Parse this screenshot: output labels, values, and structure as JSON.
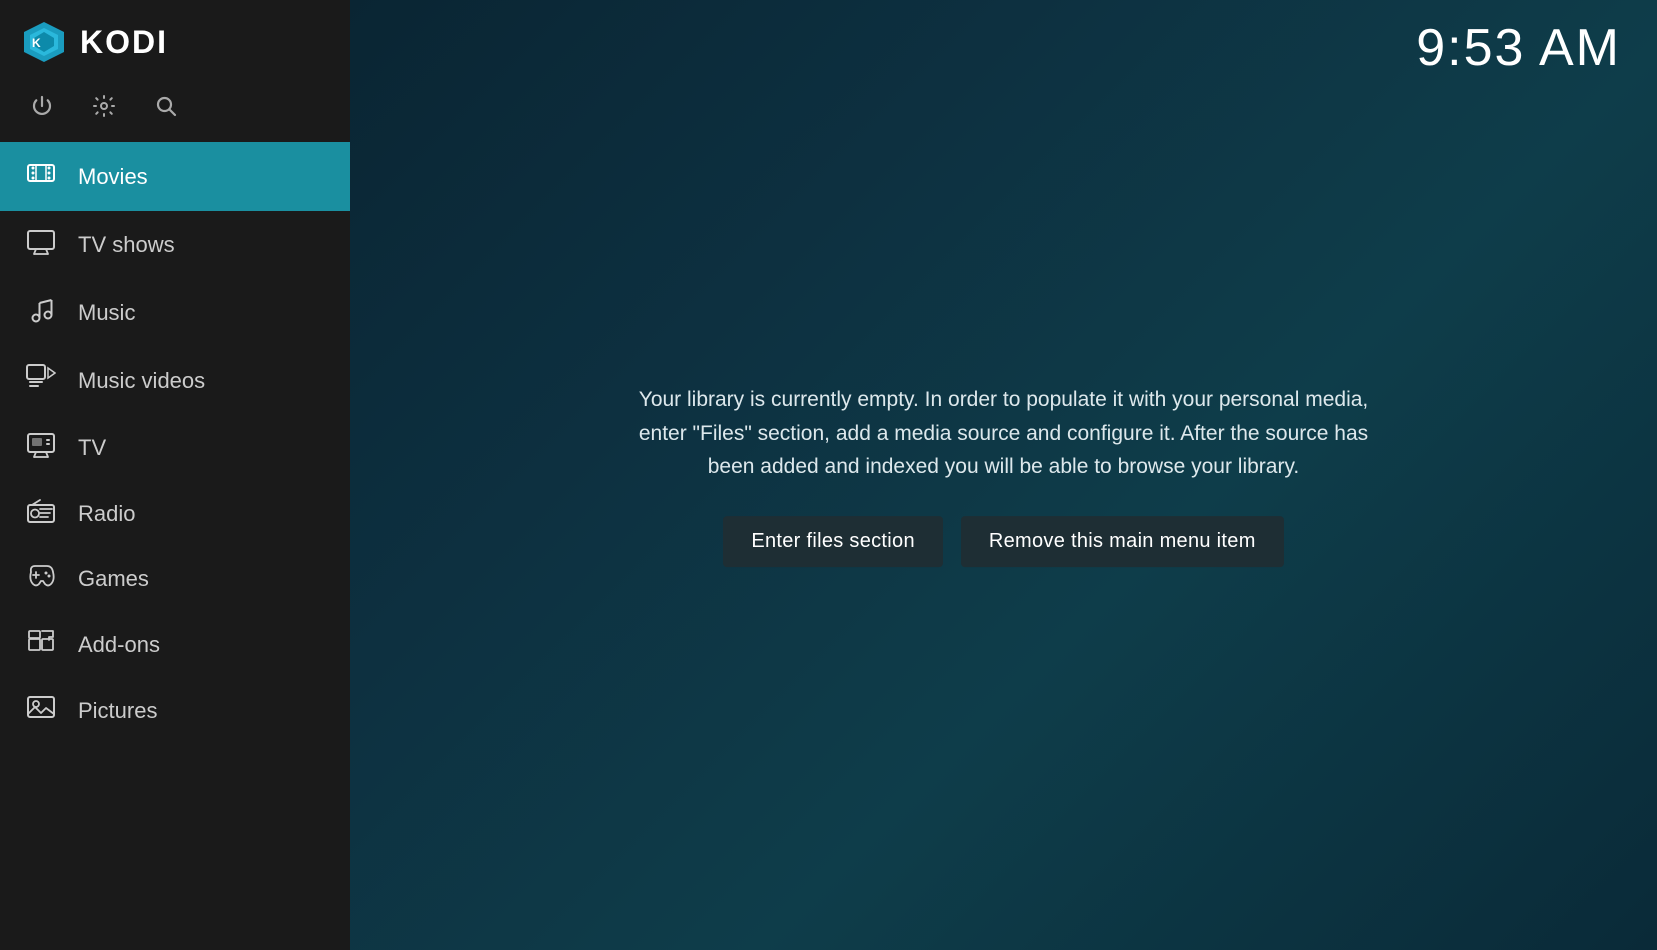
{
  "header": {
    "app_name": "KODI",
    "clock": "9:53 AM"
  },
  "sidebar": {
    "icons": [
      {
        "name": "power-icon",
        "symbol": "⏻",
        "label": "Power"
      },
      {
        "name": "settings-icon",
        "symbol": "⚙",
        "label": "Settings"
      },
      {
        "name": "search-icon",
        "symbol": "🔍",
        "label": "Search"
      }
    ],
    "nav_items": [
      {
        "id": "movies",
        "label": "Movies",
        "icon": "🎬",
        "active": true
      },
      {
        "id": "tv-shows",
        "label": "TV shows",
        "icon": "📺",
        "active": false
      },
      {
        "id": "music",
        "label": "Music",
        "icon": "🎧",
        "active": false
      },
      {
        "id": "music-videos",
        "label": "Music videos",
        "icon": "🎞",
        "active": false
      },
      {
        "id": "tv",
        "label": "TV",
        "icon": "📡",
        "active": false
      },
      {
        "id": "radio",
        "label": "Radio",
        "icon": "📻",
        "active": false
      },
      {
        "id": "games",
        "label": "Games",
        "icon": "🎮",
        "active": false
      },
      {
        "id": "add-ons",
        "label": "Add-ons",
        "icon": "📦",
        "active": false
      },
      {
        "id": "pictures",
        "label": "Pictures",
        "icon": "🖼",
        "active": false
      }
    ]
  },
  "main": {
    "library_message": "Your library is currently empty. In order to populate it with your personal media, enter \"Files\" section, add a media source and configure it. After the source has been added and indexed you will be able to browse your library.",
    "button_enter_files": "Enter files section",
    "button_remove_menu": "Remove this main menu item"
  }
}
